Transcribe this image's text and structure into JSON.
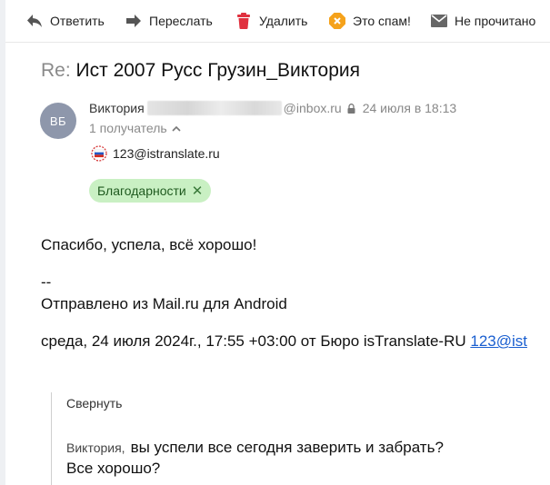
{
  "toolbar": {
    "reply": "Ответить",
    "forward": "Переслать",
    "delete": "Удалить",
    "spam": "Это спам!",
    "unread": "Не прочитано"
  },
  "message": {
    "subject_prefix": "Re:",
    "subject": "Ист 2007 Русс Грузин_Виктория",
    "avatar_initials": "ВБ",
    "avatar_color": "#8e97ab",
    "sender_name": "Виктория",
    "sender_domain": "@inbox.ru",
    "date": "24 июля в 18:13",
    "recipients_count": "1 получатель",
    "recipient_email": "123@istranslate.ru",
    "label": "Благодарности",
    "label_color": "#c9f0c3"
  },
  "body": {
    "line1": "Спасибо, успела, всё хорошо!",
    "line2": "--",
    "line3": "Отправлено из Mail.ru для Android",
    "line4_prefix": "среда, 24 июля 2024г., 17:55 +03:00 от Бюро isTranslate-RU ",
    "line4_link": "123@ist",
    "collapse": "Свернуть",
    "quote_author": "Виктория,",
    "quote_line1": "вы успели все сегодня заверить и забрать?",
    "quote_line2": "Все хорошо?"
  }
}
